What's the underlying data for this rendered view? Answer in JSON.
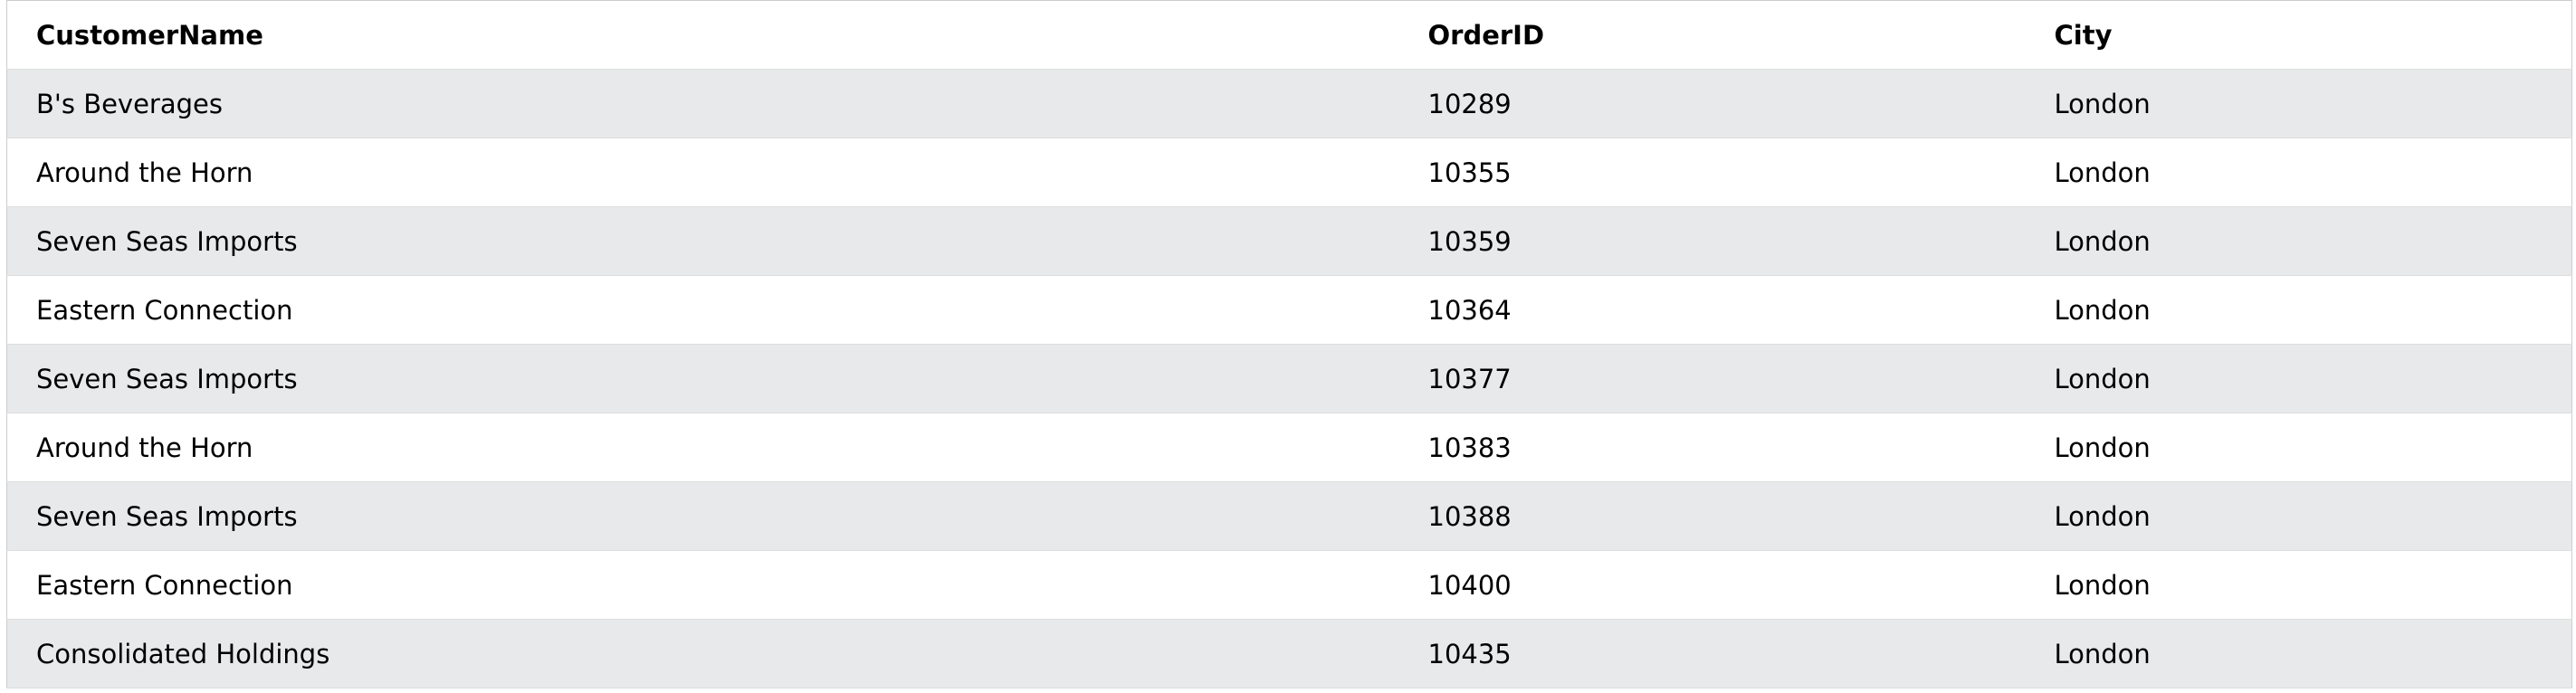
{
  "table": {
    "headers": [
      "CustomerName",
      "OrderID",
      "City"
    ],
    "rows": [
      [
        "B's Beverages",
        "10289",
        "London"
      ],
      [
        "Around the Horn",
        "10355",
        "London"
      ],
      [
        "Seven Seas Imports",
        "10359",
        "London"
      ],
      [
        "Eastern Connection",
        "10364",
        "London"
      ],
      [
        "Seven Seas Imports",
        "10377",
        "London"
      ],
      [
        "Around the Horn",
        "10383",
        "London"
      ],
      [
        "Seven Seas Imports",
        "10388",
        "London"
      ],
      [
        "Eastern Connection",
        "10400",
        "London"
      ],
      [
        "Consolidated Holdings",
        "10435",
        "London"
      ]
    ]
  },
  "colors": {
    "stripe": "#e7e9eb",
    "background": "#ffffff",
    "border": "#dddddd"
  }
}
